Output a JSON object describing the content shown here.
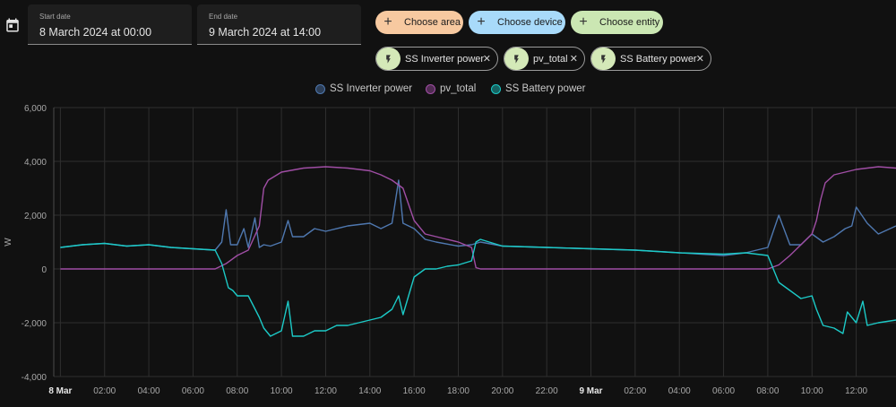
{
  "toolbar": {
    "calendar_icon": "calendar-icon",
    "start_date": {
      "label": "Start date",
      "value": "8 March 2024 at 00:00"
    },
    "end_date": {
      "label": "End date",
      "value": "9 March 2024 at 14:00"
    },
    "choose_area": {
      "label": "Choose area",
      "color": "#f7c9a0"
    },
    "choose_device": {
      "label": "Choose device",
      "color": "#a8dafa"
    },
    "choose_entity": {
      "label": "Choose entity",
      "color": "#cbe7b3"
    }
  },
  "selected": [
    {
      "label": "SS Inverter power",
      "icon": "flash-icon"
    },
    {
      "label": "pv_total",
      "icon": "flash-icon"
    },
    {
      "label": "SS Battery power",
      "icon": "flash-icon"
    }
  ],
  "colors": {
    "inverter": "#4f78b0",
    "pv": "#a04ea5",
    "battery": "#1ccac7",
    "grid": "#2f2f2f",
    "axis_text": "#a8a8a8"
  },
  "chart_data": {
    "type": "line",
    "title": "",
    "xlabel": "",
    "ylabel": "W",
    "ylim": [
      -4000,
      6000
    ],
    "yticks": [
      -4000,
      -2000,
      0,
      2000,
      4000,
      6000
    ],
    "ytick_labels": [
      "-4,000",
      "-2,000",
      "0",
      "2,000",
      "4,000",
      "6,000"
    ],
    "xlim_hours": [
      -0.3,
      37.8
    ],
    "xticks": [
      {
        "h": 0,
        "label": "8 Mar",
        "bold": true
      },
      {
        "h": 2,
        "label": "02:00"
      },
      {
        "h": 4,
        "label": "04:00"
      },
      {
        "h": 6,
        "label": "06:00"
      },
      {
        "h": 8,
        "label": "08:00"
      },
      {
        "h": 10,
        "label": "10:00"
      },
      {
        "h": 12,
        "label": "12:00"
      },
      {
        "h": 14,
        "label": "14:00"
      },
      {
        "h": 16,
        "label": "16:00"
      },
      {
        "h": 18,
        "label": "18:00"
      },
      {
        "h": 20,
        "label": "20:00"
      },
      {
        "h": 22,
        "label": "22:00"
      },
      {
        "h": 24,
        "label": "9 Mar",
        "bold": true
      },
      {
        "h": 26,
        "label": "02:00"
      },
      {
        "h": 28,
        "label": "04:00"
      },
      {
        "h": 30,
        "label": "06:00"
      },
      {
        "h": 32,
        "label": "08:00"
      },
      {
        "h": 34,
        "label": "10:00"
      },
      {
        "h": 36,
        "label": "12:00"
      }
    ],
    "legend": [
      "SS Inverter power",
      "pv_total",
      "SS Battery power"
    ],
    "legend_position": "top-center",
    "grid": true,
    "series": [
      {
        "name": "SS Inverter power",
        "color": "#4f78b0",
        "x": [
          0,
          1,
          2,
          3,
          4,
          5,
          6,
          7,
          7.3,
          7.5,
          7.7,
          8,
          8.3,
          8.5,
          8.8,
          9,
          9.2,
          9.5,
          10,
          10.3,
          10.5,
          11,
          11.5,
          12,
          13,
          14,
          14.5,
          15,
          15.3,
          15.5,
          16,
          16.5,
          17,
          18,
          18.6,
          19,
          20,
          22,
          24,
          26,
          28,
          29,
          30,
          31,
          32,
          32.5,
          33,
          33.5,
          34,
          34.5,
          35,
          35.5,
          35.8,
          36,
          36.5,
          37,
          37.8
        ],
        "y": [
          800,
          900,
          950,
          850,
          900,
          800,
          750,
          700,
          1000,
          2200,
          900,
          900,
          1500,
          800,
          1900,
          800,
          900,
          850,
          1000,
          1800,
          1200,
          1200,
          1500,
          1400,
          1600,
          1700,
          1500,
          1700,
          3300,
          1700,
          1500,
          1100,
          1000,
          850,
          900,
          1000,
          850,
          800,
          750,
          700,
          600,
          550,
          500,
          600,
          800,
          2000,
          900,
          900,
          1300,
          1000,
          1200,
          1500,
          1600,
          2300,
          1700,
          1300,
          1600
        ]
      },
      {
        "name": "pv_total",
        "color": "#a04ea5",
        "x": [
          0,
          1,
          2,
          3,
          4,
          5,
          6,
          7,
          7.2,
          7.5,
          8,
          8.5,
          9,
          9.2,
          9.4,
          9.6,
          9.8,
          10,
          11,
          12,
          13,
          14,
          14.5,
          15,
          15.5,
          16,
          16.5,
          17,
          18,
          18.6,
          18.8,
          19,
          20,
          22,
          24,
          26,
          28,
          30,
          31,
          32,
          32.5,
          33,
          33.5,
          34,
          34.2,
          34.4,
          34.6,
          35,
          36,
          36.5,
          37,
          37.8
        ],
        "y": [
          0,
          0,
          0,
          0,
          0,
          0,
          0,
          0,
          80,
          200,
          500,
          700,
          1600,
          3000,
          3300,
          3400,
          3500,
          3600,
          3750,
          3800,
          3750,
          3650,
          3500,
          3300,
          3000,
          1800,
          1300,
          1200,
          1000,
          800,
          50,
          0,
          0,
          0,
          0,
          0,
          0,
          0,
          0,
          0,
          150,
          500,
          900,
          1300,
          1800,
          2600,
          3200,
          3500,
          3700,
          3750,
          3800,
          3750
        ]
      },
      {
        "name": "SS Battery power",
        "color": "#1ccac7",
        "x": [
          0,
          1,
          2,
          3,
          4,
          5,
          6,
          7,
          7.3,
          7.6,
          7.8,
          8,
          8.5,
          9,
          9.2,
          9.5,
          10,
          10.3,
          10.5,
          11,
          11.5,
          12,
          12.5,
          13,
          14,
          14.5,
          15,
          15.3,
          15.5,
          16,
          16.5,
          17,
          17.5,
          18,
          18.6,
          18.8,
          19,
          20,
          22,
          24,
          26,
          28,
          30,
          31,
          32,
          32.5,
          33,
          33.5,
          34,
          34.2,
          34.5,
          35,
          35.4,
          35.6,
          36,
          36.3,
          36.5,
          37,
          37.8
        ],
        "y": [
          800,
          900,
          950,
          850,
          900,
          800,
          750,
          700,
          200,
          -700,
          -800,
          -1000,
          -1000,
          -1800,
          -2200,
          -2500,
          -2300,
          -1200,
          -2500,
          -2500,
          -2300,
          -2300,
          -2100,
          -2100,
          -1900,
          -1800,
          -1500,
          -1000,
          -1700,
          -300,
          0,
          0,
          100,
          150,
          300,
          1000,
          1100,
          850,
          800,
          750,
          700,
          600,
          550,
          600,
          500,
          -500,
          -800,
          -1100,
          -1000,
          -1500,
          -2100,
          -2200,
          -2400,
          -1600,
          -2000,
          -1200,
          -2100,
          -2000,
          -1900
        ]
      }
    ]
  }
}
